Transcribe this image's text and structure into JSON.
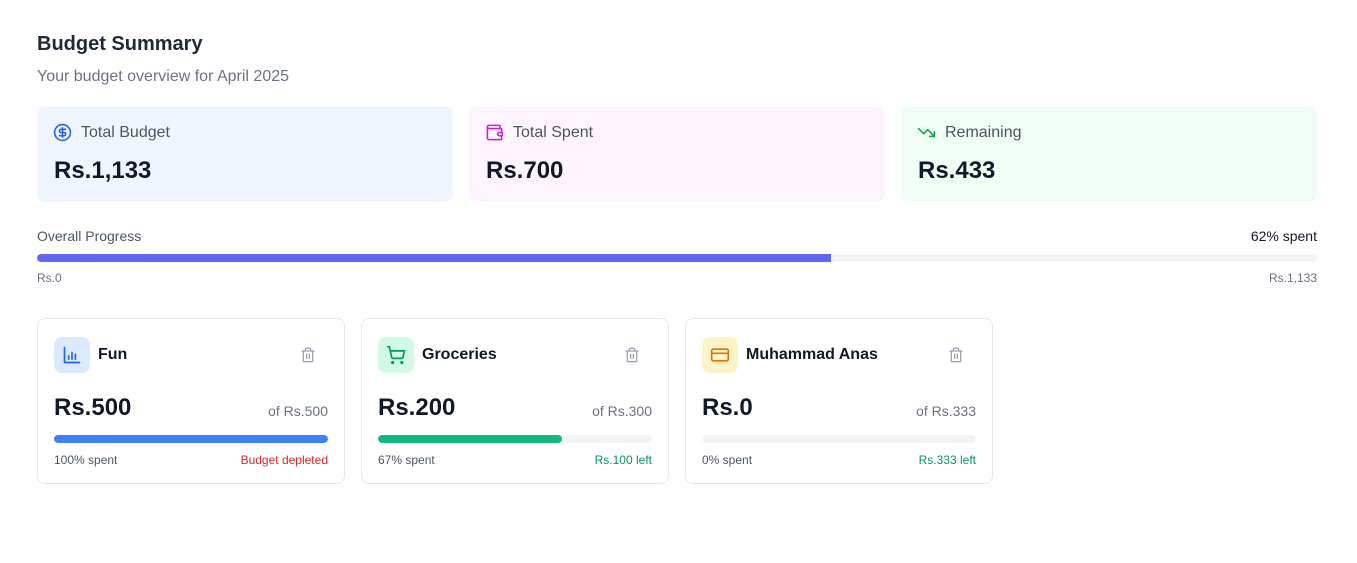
{
  "header": {
    "title": "Budget Summary",
    "subtitle": "Your budget overview for April 2025"
  },
  "stats": [
    {
      "label": "Total Budget",
      "value": "Rs.1,133",
      "icon": "dollar-circle-icon",
      "color": "#2563eb"
    },
    {
      "label": "Total Spent",
      "value": "Rs.700",
      "icon": "wallet-icon",
      "color": "#c026d3"
    },
    {
      "label": "Remaining",
      "value": "Rs.433",
      "icon": "trending-down-icon",
      "color": "#16a34a"
    }
  ],
  "overall": {
    "label": "Overall Progress",
    "percent_text": "62% spent",
    "percent": 62,
    "min_label": "Rs.0",
    "max_label": "Rs.1,133",
    "bar_color": "#6366f1"
  },
  "categories": [
    {
      "name": "Fun",
      "icon": "bar-chart-icon",
      "icon_color": "#2563eb",
      "icon_bg": "#dbeafe",
      "spent": "Rs.500",
      "of_text": "of Rs.500",
      "percent": 100,
      "percent_text": "100% spent",
      "status_text": "Budget depleted",
      "status_color": "#dc2626",
      "bar_color": "#3b82f6"
    },
    {
      "name": "Groceries",
      "icon": "shopping-cart-icon",
      "icon_color": "#059669",
      "icon_bg": "#d1fae5",
      "spent": "Rs.200",
      "of_text": "of Rs.300",
      "percent": 67,
      "percent_text": "67% spent",
      "status_text": "Rs.100 left",
      "status_color": "#059669",
      "bar_color": "#10b981"
    },
    {
      "name": "Muhammad Anas",
      "icon": "credit-card-icon",
      "icon_color": "#d97706",
      "icon_bg": "#fef3c7",
      "spent": "Rs.0",
      "of_text": "of Rs.333",
      "percent": 0,
      "percent_text": "0% spent",
      "status_text": "Rs.333 left",
      "status_color": "#059669",
      "bar_color": "#f59e0b"
    }
  ]
}
